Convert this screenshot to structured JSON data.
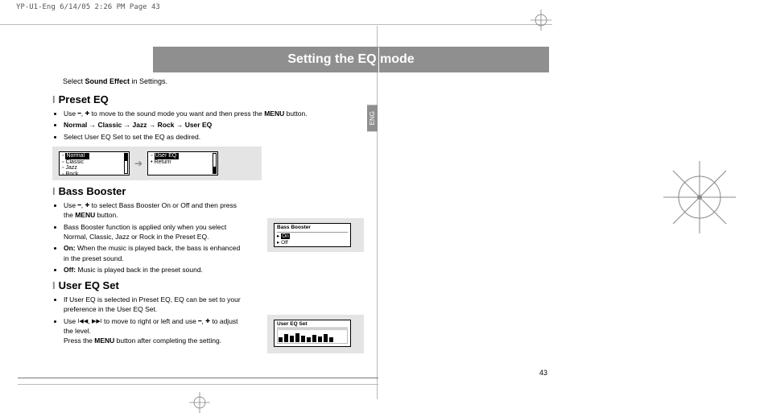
{
  "print_header": "YP-U1-Eng  6/14/05 2:26 PM  Page 43",
  "title": "Setting the EQ mode",
  "intro_pre": "Select ",
  "intro_bold": "Sound Effect",
  "intro_post": " in Settings.",
  "side_tab": "ENG",
  "page_number": "43",
  "preset": {
    "heading": "Preset EQ",
    "b1_pre": "Use ",
    "b1_post": " to move to the sound mode you want and then press the ",
    "b1_menu": "MENU",
    "b1_end": " button.",
    "b2_items": "Normal  → Classic  → Jazz  → Rock  → User EQ",
    "b3": "Select User EQ Set to set the EQ as dedired.",
    "lcd1": {
      "r1": "Normal",
      "r2": "Classic",
      "r3": "Jazz",
      "r4": "Rock"
    },
    "lcd2": {
      "r1": "User EQ",
      "r2": "Return"
    }
  },
  "bass": {
    "heading": "Bass Booster",
    "b1_pre": "Use ",
    "b1_post": " to select Bass Booster On or Off and then press the ",
    "b1_menu": "MENU",
    "b1_end": " button.",
    "b2": "Bass Booster function is applied only when you select Normal, Classic, Jazz or Rock in the Preset EQ.",
    "b3_label": "On:",
    "b3_text": " When the music is played back, the bass is enhanced in the preset sound.",
    "b4_label": "Off:",
    "b4_text": " Music is played back in the preset sound.",
    "lcd": {
      "title": "Bass Booster",
      "r1": "On",
      "r2": "Off"
    }
  },
  "usereq": {
    "heading": "User EQ Set",
    "b1": "If User EQ is selected in Preset EQ, EQ can be set to your preference in the User EQ Set.",
    "b2_pre": "Use ",
    "b2_mid": " to move to right or left and use ",
    "b2_post": " to adjust the level.",
    "b2_sub_pre": "Press the ",
    "b2_sub_menu": "MENU",
    "b2_sub_post": " button after completing the setting.",
    "lcd": {
      "title": "User EQ Set"
    }
  }
}
